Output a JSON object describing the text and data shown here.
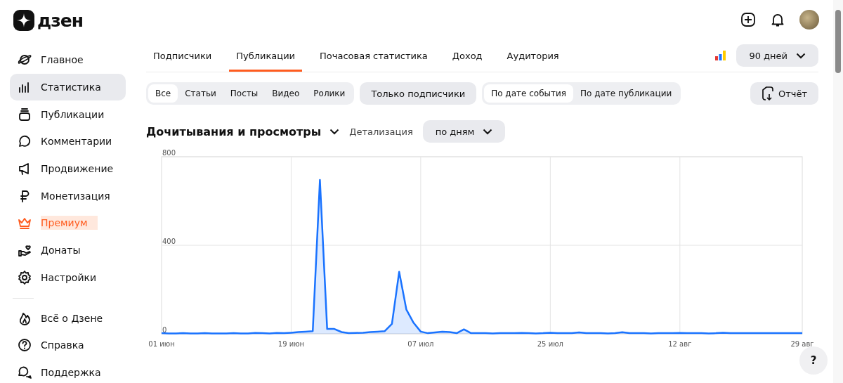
{
  "logo": {
    "text": "дзен"
  },
  "sidebar": {
    "items": [
      {
        "label": "Главное",
        "selected": false,
        "kind": "normal"
      },
      {
        "label": "Статистика",
        "selected": true,
        "kind": "normal"
      },
      {
        "label": "Публикации",
        "selected": false,
        "kind": "normal"
      },
      {
        "label": "Комментарии",
        "selected": false,
        "kind": "normal"
      },
      {
        "label": "Продвижение",
        "selected": false,
        "kind": "normal"
      },
      {
        "label": "Монетизация",
        "selected": false,
        "kind": "normal"
      },
      {
        "label": "Премиум",
        "selected": false,
        "kind": "premium"
      },
      {
        "label": "Донаты",
        "selected": false,
        "kind": "normal"
      },
      {
        "label": "Настройки",
        "selected": false,
        "kind": "normal"
      }
    ],
    "footer_items": [
      {
        "label": "Всё о Дзене",
        "selected": false
      },
      {
        "label": "Справка",
        "selected": false
      },
      {
        "label": "Поддержка",
        "selected": false
      }
    ]
  },
  "tabs": [
    {
      "label": "Подписчики",
      "selected": false
    },
    {
      "label": "Публикации",
      "selected": true
    },
    {
      "label": "Почасовая статистика",
      "selected": false
    },
    {
      "label": "Доход",
      "selected": false
    },
    {
      "label": "Аудитория",
      "selected": false
    }
  ],
  "period": {
    "value": "90 дней"
  },
  "type_filter": [
    {
      "label": "Все",
      "selected": true
    },
    {
      "label": "Статьи",
      "selected": false
    },
    {
      "label": "Посты",
      "selected": false
    },
    {
      "label": "Видео",
      "selected": false
    },
    {
      "label": "Ролики",
      "selected": false
    }
  ],
  "subscribers_only": {
    "label": "Только подписчики"
  },
  "date_filter": [
    {
      "label": "По дате события",
      "selected": true
    },
    {
      "label": "По дате публикации",
      "selected": false
    }
  ],
  "report_button": {
    "label": "Отчёт"
  },
  "metric": {
    "title": "Дочитывания и просмотры",
    "detail_label": "Детализация",
    "detail_value": "по дням"
  },
  "chart_data": {
    "type": "area",
    "ylim": [
      0,
      800
    ],
    "yticks": [
      0,
      400,
      800
    ],
    "grid": true,
    "categories": [
      "01 июн",
      null,
      null,
      null,
      null,
      null,
      null,
      null,
      null,
      null,
      null,
      null,
      null,
      null,
      null,
      null,
      null,
      null,
      "19 июн",
      null,
      null,
      null,
      null,
      null,
      null,
      null,
      null,
      null,
      null,
      null,
      null,
      null,
      null,
      null,
      null,
      null,
      "07 июл",
      null,
      null,
      null,
      null,
      null,
      null,
      null,
      null,
      null,
      null,
      null,
      null,
      null,
      null,
      null,
      null,
      null,
      "25 июл",
      null,
      null,
      null,
      null,
      null,
      null,
      null,
      null,
      null,
      null,
      null,
      null,
      null,
      null,
      null,
      null,
      null,
      "12 авг",
      null,
      null,
      null,
      null,
      null,
      null,
      null,
      null,
      null,
      null,
      null,
      null,
      null,
      null,
      null,
      null,
      "29 авг"
    ],
    "series": [
      {
        "color": "#1a73ff",
        "values": [
          3,
          2,
          2,
          3,
          2,
          2,
          3,
          2,
          2,
          2,
          3,
          2,
          2,
          4,
          3,
          2,
          4,
          3,
          5,
          8,
          10,
          12,
          695,
          22,
          22,
          8,
          3,
          4,
          5,
          8,
          10,
          12,
          45,
          280,
          110,
          50,
          10,
          3,
          6,
          10,
          8,
          3,
          20,
          3,
          3,
          3,
          2,
          3,
          3,
          3,
          4,
          3,
          2,
          3,
          5,
          3,
          3,
          3,
          6,
          3,
          3,
          3,
          2,
          3,
          7,
          3,
          3,
          3,
          2,
          3,
          3,
          3,
          4,
          3,
          3,
          3,
          2,
          3,
          5,
          3,
          3,
          3,
          3,
          3,
          3,
          3,
          3,
          3,
          3,
          3
        ]
      }
    ]
  },
  "help_button": {
    "label": "?"
  }
}
